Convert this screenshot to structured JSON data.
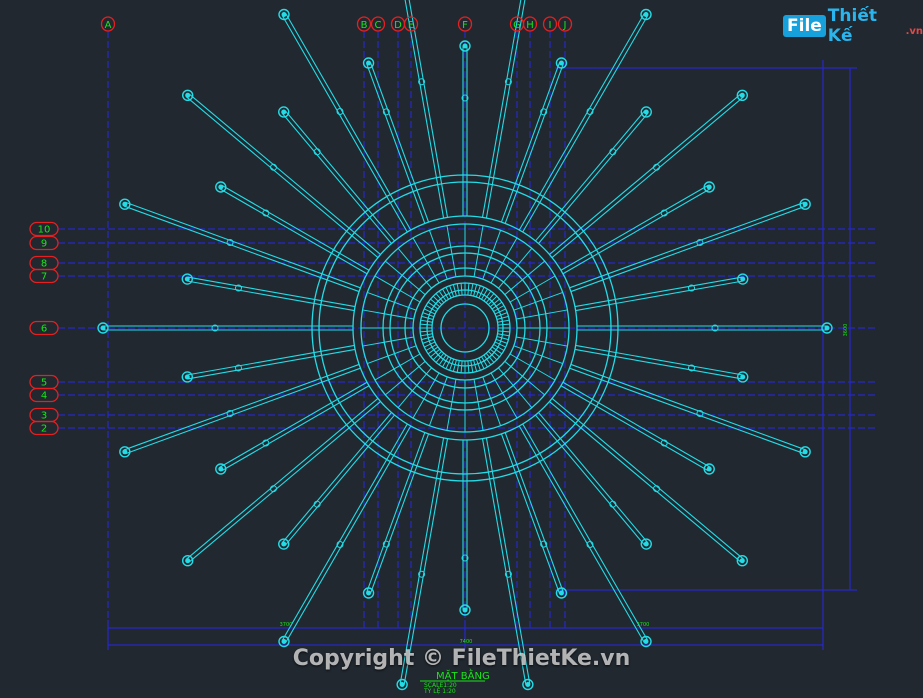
{
  "watermark": {
    "logo_file": "File",
    "logo_thietke": "Thiết Kế",
    "logo_vn": ".vn",
    "copyright": "Copyright © FileThietKe.vn"
  },
  "colors": {
    "background": "#212830",
    "geometry": "#23dce6",
    "grid_line": "#2626e6",
    "bubble": "#e62020",
    "text": "#19e619"
  },
  "grid": {
    "columns": [
      "A",
      "B",
      "C",
      "D",
      "E",
      "F",
      "G",
      "H",
      "I",
      "J"
    ],
    "rows": [
      "10",
      "9",
      "8",
      "7",
      "6",
      "5",
      "4",
      "3",
      "2"
    ]
  },
  "title": {
    "name": "MẶT BẰNG",
    "scale": "SCALE1:20",
    "ratio": "TỶ LỆ 1:20"
  },
  "dimensions": {
    "bottom_left": "3700",
    "bottom_right": "3700",
    "bottom_total": "7400",
    "right_total": "3600"
  },
  "drawing": {
    "spoke_count": 36
  }
}
